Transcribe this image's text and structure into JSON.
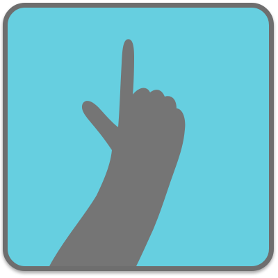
{
  "icon": {
    "name": "pointing-hand-icon",
    "background_color": "#66cfe0",
    "border_color": "#6e6e6e",
    "hand_color": "#757575"
  }
}
